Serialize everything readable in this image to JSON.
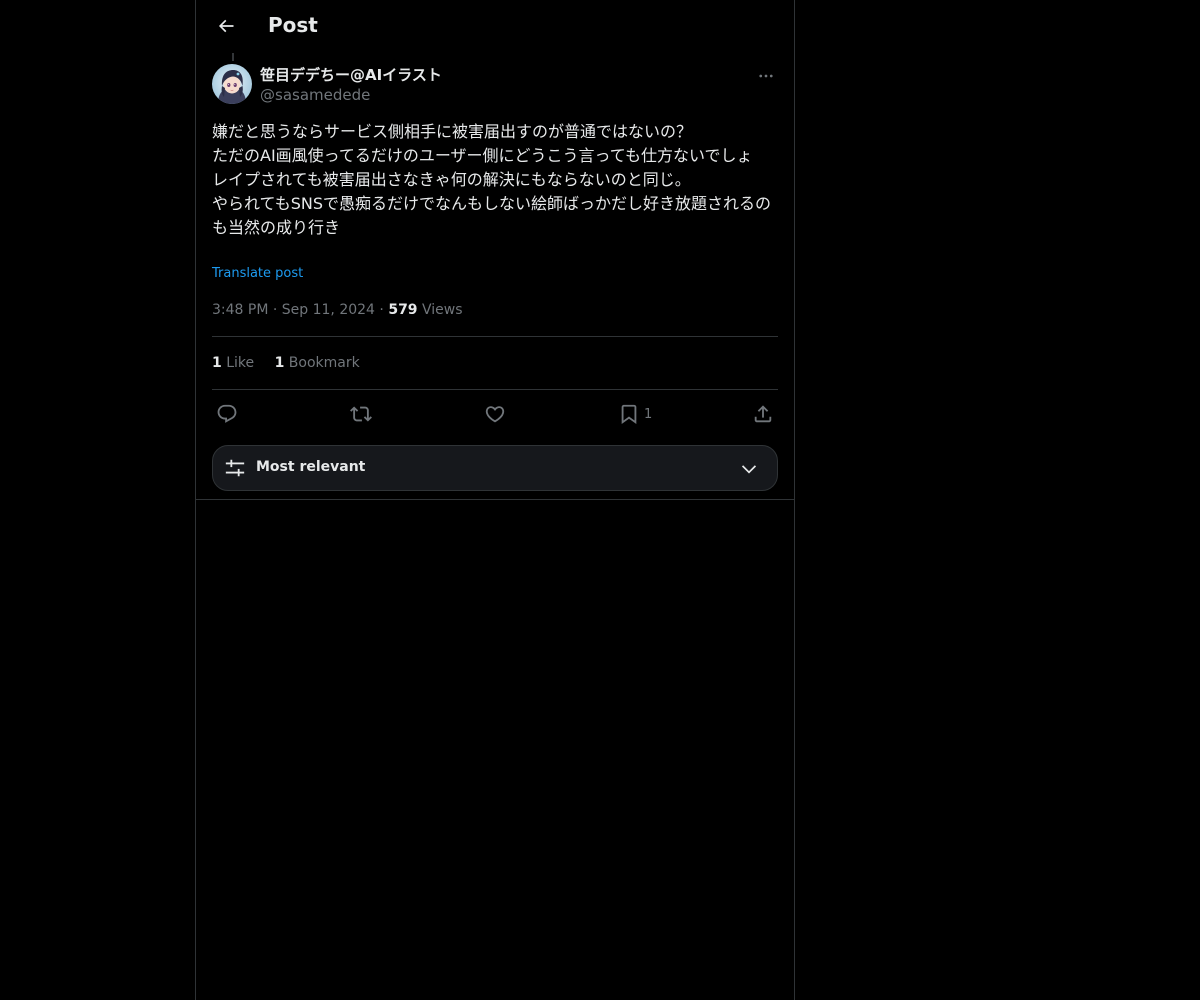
{
  "header": {
    "title": "Post"
  },
  "post": {
    "display_name": "笹目デデちー@AIイラスト",
    "handle": "@sasamedede",
    "text": "嫌だと思うならサービス側相手に被害届出すのが普通ではないの？\nただのAI画風使ってるだけのユーザー側にどうこう言っても仕方ないでしょ\nレイプされても被害届出さなきゃ何の解決にもならないのと同じ。\nやられてもSNSで愚痴るだけでなんもしない絵師ばっかだし好き放題されるのも当然の成り行き",
    "translate_label": "Translate post",
    "time": "3:48 PM",
    "date": "Sep 11, 2024",
    "separator": "·",
    "views_count": "579",
    "views_label": "Views"
  },
  "stats": {
    "likes_count": "1",
    "likes_label": "Like",
    "bookmarks_count": "1",
    "bookmarks_label": "Bookmark"
  },
  "actions": {
    "bookmark_count": "1"
  },
  "sort": {
    "label": "Most relevant"
  },
  "colors": {
    "background": "#000000",
    "text_primary": "#e7e9ea",
    "text_secondary": "#71767b",
    "accent": "#1d9bf0",
    "border": "#2f3336"
  }
}
